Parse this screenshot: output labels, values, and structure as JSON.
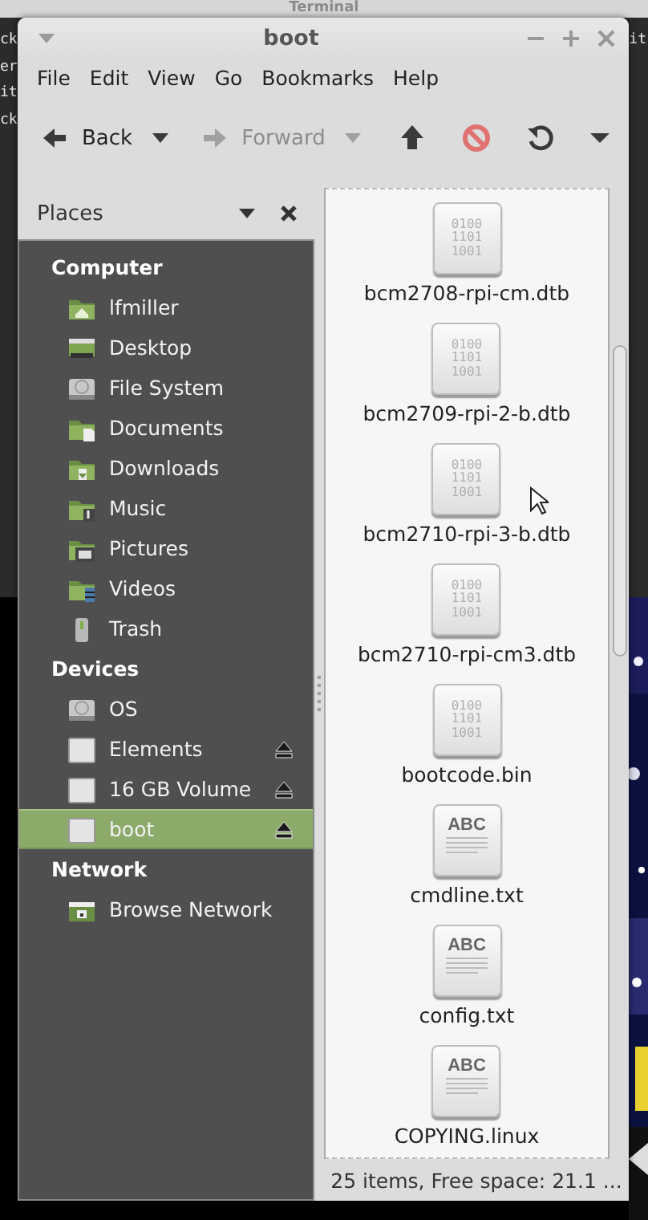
{
  "terminal": {
    "title": "Terminal",
    "lines": [
      {
        "left": "ck",
        "right": "it"
      },
      {
        "left": "er"
      },
      {
        "left": "it"
      },
      {
        "left": "ck"
      }
    ]
  },
  "window": {
    "title": "boot"
  },
  "menu": [
    "File",
    "Edit",
    "View",
    "Go",
    "Bookmarks",
    "Help"
  ],
  "toolbar": [
    {
      "kind": "back",
      "label": "Back",
      "disabled": false
    },
    {
      "kind": "forward",
      "label": "Forward",
      "disabled": true
    },
    {
      "kind": "up",
      "disabled": false
    },
    {
      "kind": "stop",
      "disabled": false
    },
    {
      "kind": "reload",
      "disabled": false
    },
    {
      "kind": "more",
      "disabled": false
    }
  ],
  "sidebar": {
    "title": "Places",
    "sections": [
      {
        "heading": "Computer",
        "items": [
          {
            "label": "lfmiller",
            "kind": "home",
            "selected": false,
            "ejectable": false
          },
          {
            "label": "Desktop",
            "kind": "desktop",
            "selected": false,
            "ejectable": false
          },
          {
            "label": "File System",
            "kind": "harddisk",
            "selected": false,
            "ejectable": false
          },
          {
            "label": "Documents",
            "kind": "documents",
            "selected": false,
            "ejectable": false
          },
          {
            "label": "Downloads",
            "kind": "downloads",
            "selected": false,
            "ejectable": false
          },
          {
            "label": "Music",
            "kind": "music",
            "selected": false,
            "ejectable": false
          },
          {
            "label": "Pictures",
            "kind": "pictures",
            "selected": false,
            "ejectable": false
          },
          {
            "label": "Videos",
            "kind": "videos",
            "selected": false,
            "ejectable": false
          },
          {
            "label": "Trash",
            "kind": "trash",
            "selected": false,
            "ejectable": false
          }
        ]
      },
      {
        "heading": "Devices",
        "items": [
          {
            "label": "OS",
            "kind": "harddisk",
            "selected": false,
            "ejectable": false
          },
          {
            "label": "Elements",
            "kind": "drive",
            "selected": false,
            "ejectable": true
          },
          {
            "label": "16 GB Volume",
            "kind": "drive",
            "selected": false,
            "ejectable": true
          },
          {
            "label": "boot",
            "kind": "drive",
            "selected": true,
            "ejectable": true
          }
        ]
      },
      {
        "heading": "Network",
        "items": [
          {
            "label": "Browse Network",
            "kind": "network",
            "selected": false,
            "ejectable": false
          }
        ]
      }
    ]
  },
  "files": [
    {
      "name": "bcm2708-rpi-cm.dtb",
      "kind": "binary",
      "icon_lines": [
        "0100",
        "1101",
        "1001"
      ]
    },
    {
      "name": "bcm2709-rpi-2-b.dtb",
      "kind": "binary",
      "icon_lines": [
        "0100",
        "1101",
        "1001"
      ]
    },
    {
      "name": "bcm2710-rpi-3-b.dtb",
      "kind": "binary",
      "icon_lines": [
        "0100",
        "1101",
        "1001"
      ]
    },
    {
      "name": "bcm2710-rpi-cm3.dtb",
      "kind": "binary",
      "icon_lines": [
        "0100",
        "1101",
        "1001"
      ]
    },
    {
      "name": "bootcode.bin",
      "kind": "binary",
      "icon_lines": [
        "0100",
        "1101",
        "1001"
      ]
    },
    {
      "name": "cmdline.txt",
      "kind": "text",
      "icon_lines": [
        "ABC"
      ]
    },
    {
      "name": "config.txt",
      "kind": "text",
      "icon_lines": [
        "ABC"
      ]
    },
    {
      "name": "COPYING.linux",
      "kind": "text",
      "icon_lines": [
        "ABC"
      ]
    }
  ],
  "status_bar": "25 items, Free space: 21.1 ..."
}
